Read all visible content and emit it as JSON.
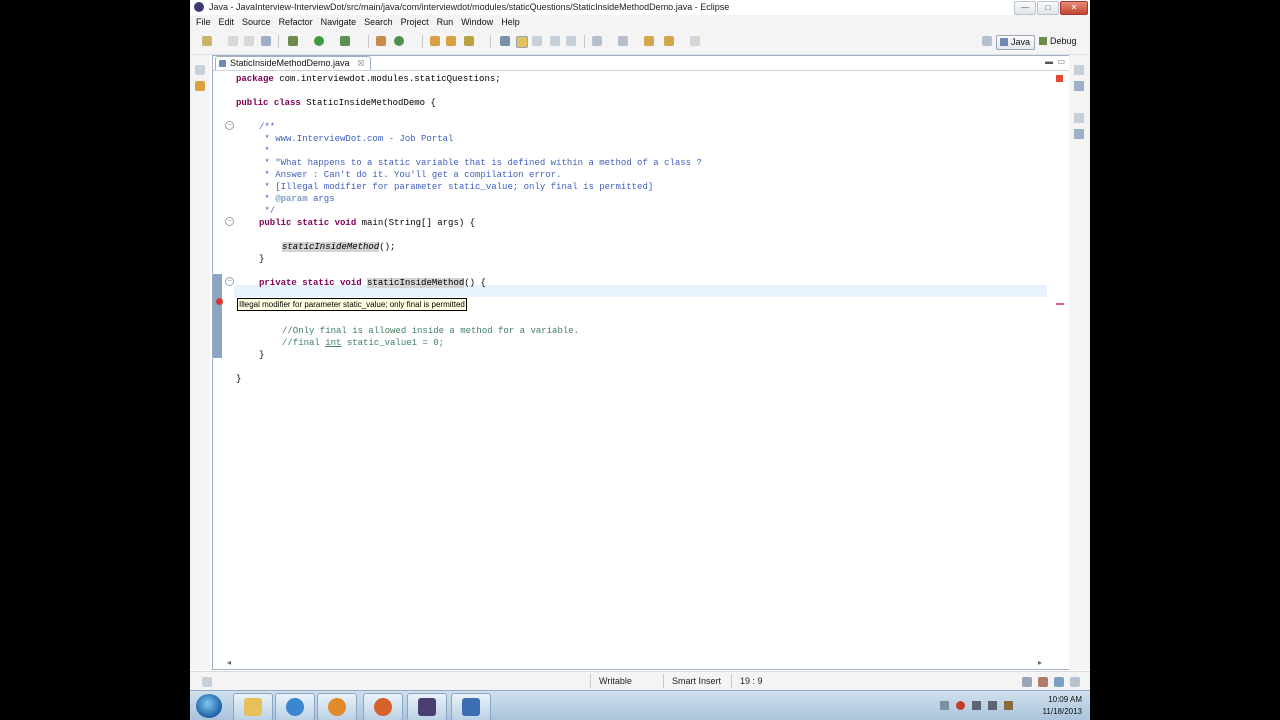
{
  "window": {
    "title": "Java - JavaInterview-InterviewDot/src/main/java/com/interviewdot/modules/staticQuestions/StaticInsideMethodDemo.java - Eclipse",
    "minimize": "—",
    "maximize": "□",
    "close": "✕"
  },
  "menubar": {
    "items": [
      "File",
      "Edit",
      "Source",
      "Refactor",
      "Navigate",
      "Search",
      "Project",
      "Run",
      "Window",
      "Help"
    ]
  },
  "perspectives": {
    "java": "Java",
    "debug": "Debug"
  },
  "editor": {
    "tab_label": "StaticInsideMethodDemo.java",
    "tab_close": "☒",
    "code": {
      "package_kw": "package",
      "package_rest": " com.interviewdot.modules.staticQuestions;",
      "class_kw1": "public",
      "class_kw2": "class",
      "class_rest": " StaticInsideMethodDemo {",
      "doc_open": "/**",
      "doc_line1": " * www.InterviewDot.com - Job Portal",
      "doc_line2": " *",
      "doc_line3": " * \"What happens to a static variable that is defined within a method of a class ?",
      "doc_line4": " * Answer : Can't do it. You'll get a compilation error.",
      "doc_line5": " * [Illegal modifier for parameter static_value; only final is permitted]",
      "doc_line6_star": " * ",
      "doc_line6_tag": "@param",
      "doc_line6_rest": " args",
      "doc_close": " */",
      "main_kw1": "public",
      "main_kw2": "static",
      "main_kw3": "void",
      "main_rest": " main(String[] args) {",
      "call_name": "staticInsideMethod",
      "call_rest": "();",
      "close_brace1": "}",
      "private_kw1": "private",
      "private_kw2": "static",
      "private_kw3": "void",
      "private_name": "staticInsideMethod",
      "private_rest": "() {",
      "comment1": "//Only final is allowed inside a method for a variable.",
      "comment2_a": "//final ",
      "comment2_int": "int",
      "comment2_b": " static_value1 = 0;",
      "close_brace2": "}",
      "close_brace3": "}"
    },
    "tooltip": "Illegal modifier for parameter static_value; only final is permitted"
  },
  "statusbar": {
    "writable": "Writable",
    "insert_mode": "Smart Insert",
    "position": "19 : 9"
  },
  "taskbar": {
    "time": "10:09 AM",
    "date": "11/18/2013"
  },
  "colors": {
    "keyword": "#7f0055",
    "comment": "#3f7f5f",
    "javadoc": "#3f5fbf",
    "error": "#d03b2f",
    "current_line": "#e8f2fe",
    "tooltip_bg": "#ffffe1"
  }
}
